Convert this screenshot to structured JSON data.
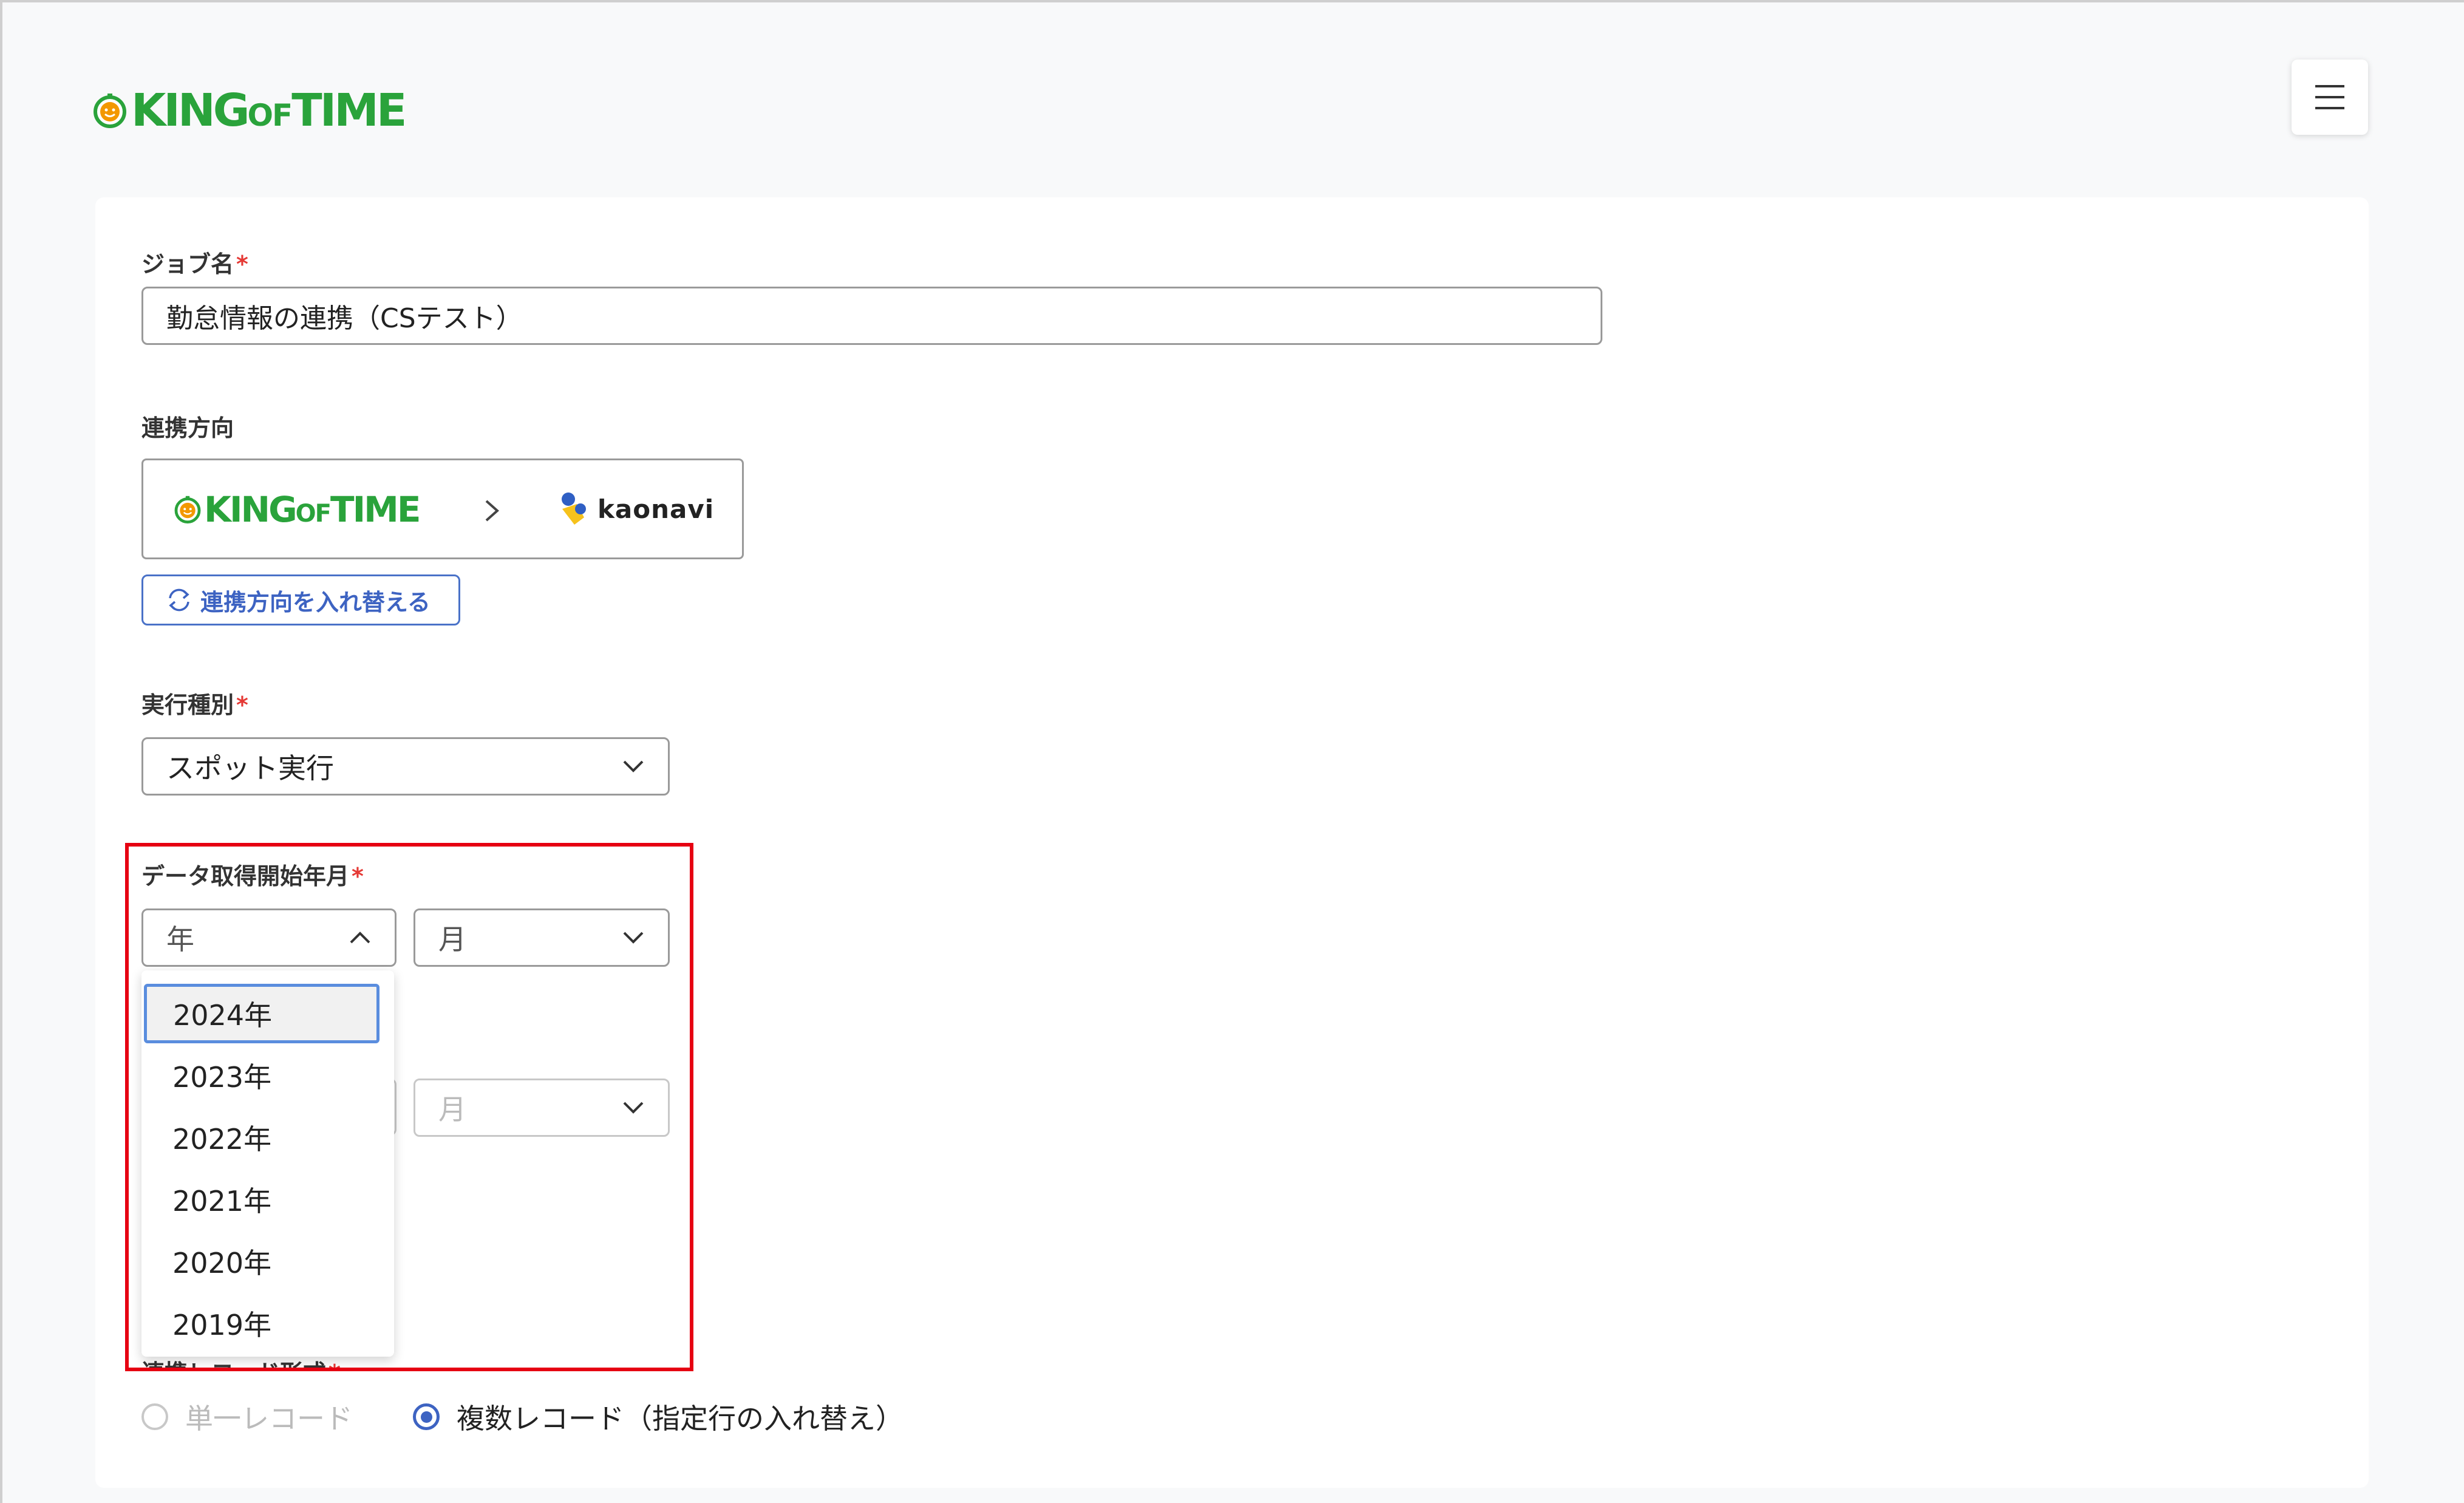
{
  "header": {
    "logo_text_king": "KING",
    "logo_text_of": "OF",
    "logo_text_time": "TIME",
    "menu_icon": "hamburger-icon"
  },
  "form": {
    "job_name": {
      "label": "ジョブ名",
      "required_mark": "*",
      "value": "勤怠情報の連携（CSテスト）"
    },
    "direction": {
      "label": "連携方向",
      "from_king": "KING",
      "from_of": "OF",
      "from_time": "TIME",
      "to": "kaonavi",
      "swap_button": "連携方向を入れ替える"
    },
    "execution_type": {
      "label": "実行種別",
      "required_mark": "*",
      "value": "スポット実行"
    },
    "start_month": {
      "label": "データ取得開始年月",
      "required_mark": "*",
      "year_placeholder": "年",
      "month_placeholder": "月",
      "year_options": [
        "2024年",
        "2023年",
        "2022年",
        "2021年",
        "2020年",
        "2019年"
      ],
      "active_option": "2024年"
    },
    "end_month": {
      "month_placeholder": "月"
    },
    "record_format": {
      "label": "連携レコード形式",
      "required_mark": "*",
      "options": [
        {
          "label": "単一レコード",
          "selected": false,
          "disabled": true
        },
        {
          "label": "複数レコード（指定行の入れ替え）",
          "selected": true,
          "disabled": false
        }
      ]
    }
  },
  "colors": {
    "brand_green": "#2aa33b",
    "accent_blue": "#3d63c2",
    "highlight_red": "#e60012",
    "required_red": "#e53935"
  }
}
